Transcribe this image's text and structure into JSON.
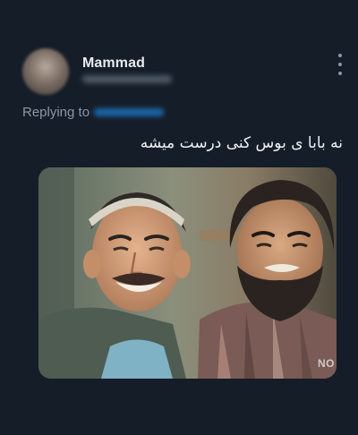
{
  "tweet": {
    "author_name": "Mammad",
    "replying_label": "Replying to",
    "text": "نه بابا ی بوس کنی درست میشه",
    "media_alt": "Photo of two smiling men",
    "media_watermark": "NO"
  },
  "icons": {
    "more": "more-vertical-icon"
  },
  "colors": {
    "background": "#151d28",
    "text_primary": "#e9edf1",
    "text_secondary": "#8b98a5",
    "accent": "#1d7fd1"
  }
}
